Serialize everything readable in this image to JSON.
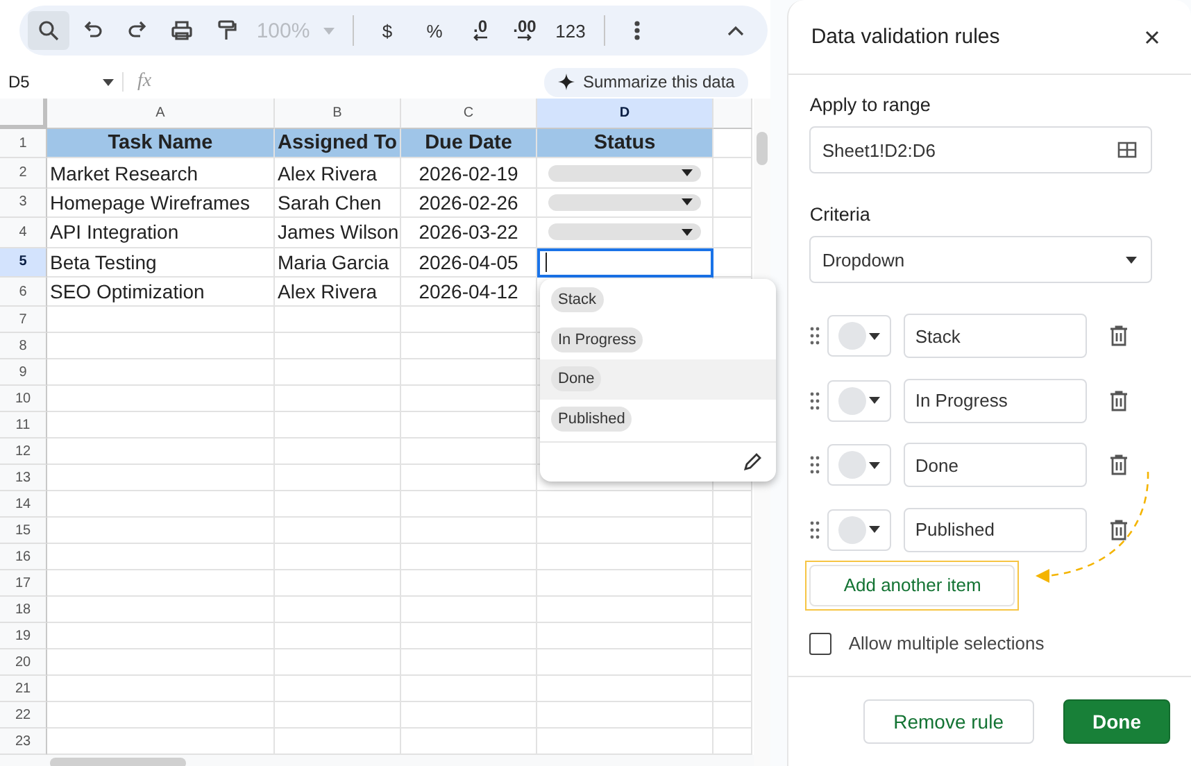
{
  "toolbar": [
    {
      "kind": "search",
      "selected": true
    },
    {
      "kind": "undo",
      "selected": false
    },
    {
      "kind": "redo",
      "selected": false
    },
    {
      "kind": "print",
      "selected": false
    },
    {
      "kind": "paint-format",
      "selected": false
    },
    {
      "kind": "zoom",
      "label": "100%",
      "disabled": true
    },
    {
      "kind": "divider"
    },
    {
      "kind": "text",
      "label": "$"
    },
    {
      "kind": "text",
      "label": "%"
    },
    {
      "kind": "decimal-down",
      "label": ".0"
    },
    {
      "kind": "decimal-up",
      "label": ".00"
    },
    {
      "kind": "text",
      "label": "123"
    },
    {
      "kind": "divider"
    },
    {
      "kind": "more",
      "selected": false
    },
    {
      "kind": "collapse",
      "selected": false
    }
  ],
  "formula_bar": {
    "name_box": "D5",
    "fx": "fx",
    "summarize_button": "Summarize this data"
  },
  "columns": [
    {
      "label": "A",
      "selected": false
    },
    {
      "label": "B",
      "selected": false
    },
    {
      "label": "C",
      "selected": false
    },
    {
      "label": "D",
      "selected": true
    }
  ],
  "rows": [
    {
      "number": "1",
      "selected": false,
      "kind": "header",
      "cells": [
        "Task Name",
        "Assigned To",
        "Due Date",
        "Status"
      ]
    },
    {
      "number": "2",
      "selected": false,
      "kind": "data",
      "cells": [
        "Market Research",
        "Alex Rivera",
        "2026-02-19"
      ],
      "status": {
        "kind": "dropdown"
      }
    },
    {
      "number": "3",
      "selected": false,
      "kind": "data",
      "cells": [
        "Homepage Wireframes",
        "Sarah Chen",
        "2026-02-26"
      ],
      "status": {
        "kind": "dropdown"
      }
    },
    {
      "number": "4",
      "selected": false,
      "kind": "data",
      "cells": [
        "API Integration",
        "James Wilson",
        "2026-03-22"
      ],
      "status": {
        "kind": "dropdown"
      }
    },
    {
      "number": "5",
      "selected": true,
      "kind": "data",
      "cells": [
        "Beta Testing",
        "Maria Garcia",
        "2026-04-05"
      ],
      "status": {
        "kind": "editing"
      }
    },
    {
      "number": "6",
      "selected": false,
      "kind": "data",
      "cells": [
        "SEO Optimization",
        "Alex Rivera",
        "2026-04-12"
      ],
      "status": {
        "kind": "blank"
      }
    },
    {
      "number": "7",
      "selected": false,
      "kind": "empty"
    },
    {
      "number": "8",
      "selected": false,
      "kind": "empty"
    },
    {
      "number": "9",
      "selected": false,
      "kind": "empty"
    },
    {
      "number": "10",
      "selected": false,
      "kind": "empty"
    },
    {
      "number": "11",
      "selected": false,
      "kind": "empty"
    },
    {
      "number": "12",
      "selected": false,
      "kind": "empty"
    },
    {
      "number": "13",
      "selected": false,
      "kind": "empty"
    },
    {
      "number": "14",
      "selected": false,
      "kind": "empty"
    },
    {
      "number": "15",
      "selected": false,
      "kind": "empty"
    },
    {
      "number": "16",
      "selected": false,
      "kind": "empty"
    },
    {
      "number": "17",
      "selected": false,
      "kind": "empty"
    },
    {
      "number": "18",
      "selected": false,
      "kind": "empty"
    },
    {
      "number": "19",
      "selected": false,
      "kind": "empty"
    },
    {
      "number": "20",
      "selected": false,
      "kind": "empty"
    },
    {
      "number": "21",
      "selected": false,
      "kind": "empty"
    },
    {
      "number": "22",
      "selected": false,
      "kind": "empty"
    },
    {
      "number": "23",
      "selected": false,
      "kind": "empty"
    }
  ],
  "dropdown_menu": {
    "options": [
      {
        "label": "Stack",
        "highlighted": false
      },
      {
        "label": "In Progress",
        "highlighted": false
      },
      {
        "label": "Done",
        "highlighted": true
      },
      {
        "label": "Published",
        "highlighted": false
      }
    ]
  },
  "panel": {
    "title": "Data validation rules",
    "range_label": "Apply to range",
    "range_value": "Sheet1!D2:D6",
    "criteria_label": "Criteria",
    "criteria_value": "Dropdown",
    "items": [
      {
        "value": "Stack"
      },
      {
        "value": "In Progress"
      },
      {
        "value": "Done"
      },
      {
        "value": "Published"
      }
    ],
    "add_item_button": {
      "label": "Add another item",
      "highlighted": true
    },
    "allow_multiple": {
      "label": "Allow multiple selections",
      "checked": false
    },
    "buttons": [
      {
        "label": "Remove rule",
        "kind": "secondary"
      },
      {
        "label": "Done",
        "kind": "primary"
      }
    ]
  }
}
